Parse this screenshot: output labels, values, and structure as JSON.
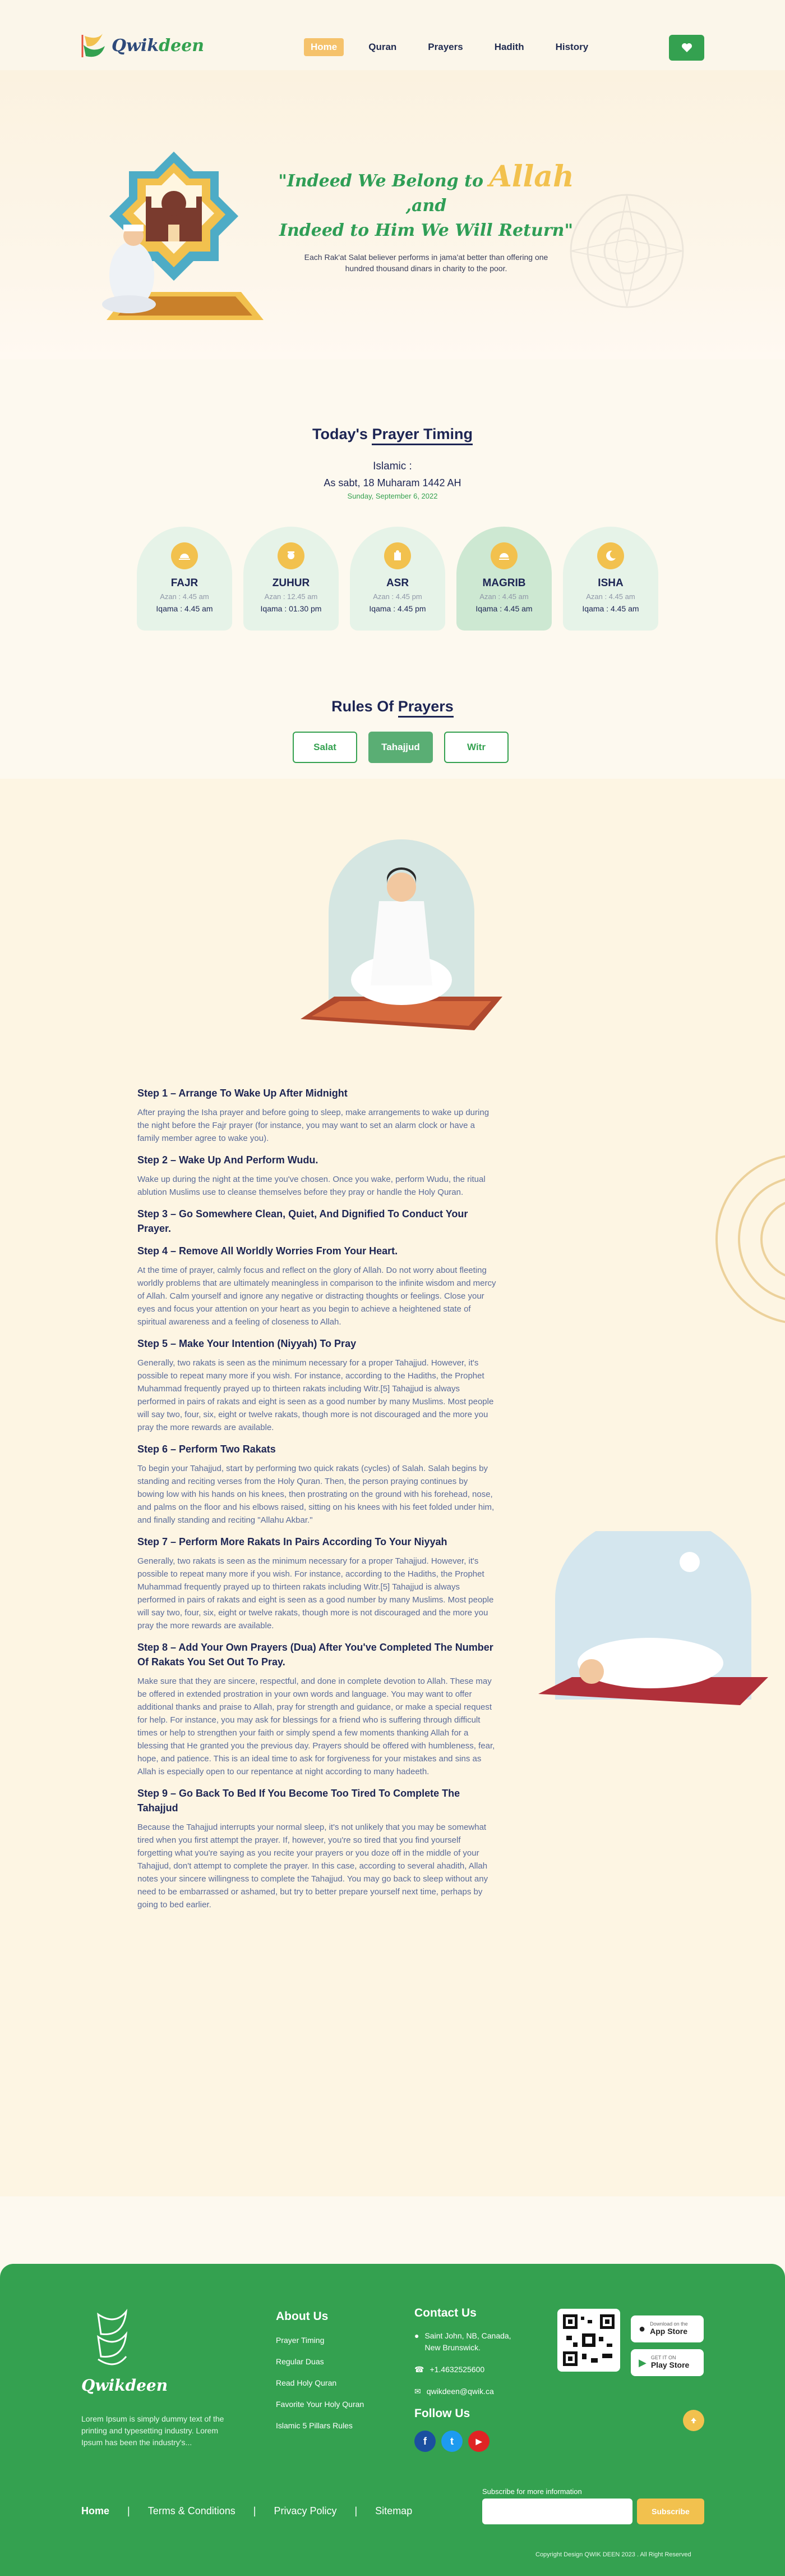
{
  "brand": {
    "logo_prefix": "Qwik",
    "logo_suffix": "deen"
  },
  "nav": {
    "items": [
      {
        "label": "Home",
        "active": true
      },
      {
        "label": "Quran",
        "active": false
      },
      {
        "label": "Prayers",
        "active": false
      },
      {
        "label": "Hadith",
        "active": false
      },
      {
        "label": "History",
        "active": false
      }
    ],
    "heart_icon": "heart-icon"
  },
  "hero": {
    "quote_before": "\"Indeed We Belong to",
    "quote_allah": "Allah",
    "quote_after": ",and",
    "quote_line2": "Indeed to Him We Will Return\"",
    "subtitle": "Each Rak'at Salat believer performs in jama'at better than offering one hundred thousand dinars in charity to the poor."
  },
  "timing": {
    "title_plain": "Today's",
    "title_ul": "Prayer Timing",
    "islamic_label": "Islamic :",
    "hijri_date": "As sabt, 18 Muharam 1442 AH",
    "greg_date": "Sunday, September 6, 2022",
    "prayers": [
      {
        "name": "FAJR",
        "azan": "Azan : 4.45 am",
        "iqama": "Iqama : 4.45 am",
        "icon": "sunrise-icon",
        "highlight": false
      },
      {
        "name": "ZUHUR",
        "azan": "Azan : 12.45 am",
        "iqama": "Iqama : 01.30 pm",
        "icon": "sun-icon",
        "highlight": false
      },
      {
        "name": "ASR",
        "azan": "Azan : 4.45 pm",
        "iqama": "Iqama : 4.45 pm",
        "icon": "sun-icon",
        "highlight": false
      },
      {
        "name": "MAGRIB",
        "azan": "Azan : 4.45 am",
        "iqama": "Iqama : 4.45 am",
        "icon": "sunset-icon",
        "highlight": true
      },
      {
        "name": "ISHA",
        "azan": "Azan : 4.45 am",
        "iqama": "Iqama : 4.45 am",
        "icon": "moon-icon",
        "highlight": false
      }
    ]
  },
  "rules": {
    "title_plain": "Rules Of",
    "title_ul": "Prayers",
    "tabs": [
      {
        "label": "Salat",
        "active": false
      },
      {
        "label": "Tahajjud",
        "active": true
      },
      {
        "label": "Witr",
        "active": false
      }
    ],
    "steps": [
      {
        "title": "Step 1 – Arrange To Wake Up After Midnight",
        "body": "After praying the Isha prayer and before going to sleep, make arrangements to wake up during the night before the Fajr prayer (for instance, you may want to set an alarm clock or have a family member agree to wake you)."
      },
      {
        "title": "Step 2 – Wake Up And Perform Wudu.",
        "body": "Wake up during the night at the time you've chosen. Once you wake, perform Wudu, the ritual ablution Muslims use to cleanse themselves before they pray or handle the Holy Quran."
      },
      {
        "title": "Step 3 – Go Somewhere Clean, Quiet, And Dignified To Conduct Your Prayer.",
        "body": ""
      },
      {
        "title": "Step 4 – Remove All Worldly Worries From Your Heart.",
        "body": "At the time of prayer, calmly focus and reflect on the glory of Allah. Do not worry about fleeting worldly problems that are ultimately meaningless in comparison to the infinite wisdom and mercy of Allah. Calm yourself and ignore any negative or distracting thoughts or feelings. Close your eyes and focus your attention on your heart as you begin to achieve a heightened state of spiritual awareness and a feeling of closeness to Allah."
      },
      {
        "title": "Step 5 – Make Your Intention (Niyyah) To Pray",
        "body": "Generally, two rakats is seen as the minimum necessary for a proper Tahajjud. However, it's possible to repeat many more if you wish. For instance, according to the Hadiths, the Prophet Muhammad frequently prayed up to thirteen rakats including Witr.[5] Tahajjud is always performed in pairs of rakats and eight is seen as a good number by many Muslims. Most people will say two, four, six, eight or twelve rakats, though more is not discouraged and the more you pray the more rewards are available."
      },
      {
        "title": "Step 6 – Perform Two Rakats",
        "body": "To begin your Tahajjud, start by performing two quick rakats (cycles) of Salah. Salah begins by standing and reciting verses from the Holy Quran. Then, the person praying continues by bowing low with his hands on his knees, then prostrating on the ground with his forehead, nose, and palms on the floor and his elbows raised, sitting on his knees with his feet folded under him, and finally standing and reciting \"Allahu Akbar.\""
      },
      {
        "title": "Step 7 – Perform More Rakats In Pairs According To Your Niyyah",
        "body": "Generally, two rakats is seen as the minimum necessary for a proper Tahajjud. However, it's possible to repeat many more if you wish. For instance, according to the Hadiths, the Prophet Muhammad frequently prayed up to thirteen rakats including Witr.[5] Tahajjud is always performed in pairs of rakats and eight is seen as a good number by many Muslims. Most people will say two, four, six, eight or twelve rakats, though more is not discouraged and the more you pray the more rewards are available."
      },
      {
        "title": "Step 8 – Add Your Own Prayers (Dua) After You've Completed The Number Of Rakats You Set Out To Pray.",
        "body": "Make sure that they are sincere, respectful, and done in complete devotion to Allah. These may be offered in extended prostration in your own words and language. You may want to offer additional thanks and praise to Allah, pray for strength and guidance, or make a special request for help. For instance, you may ask for blessings for a friend who is suffering through difficult times or help to strengthen your faith or simply spend a few moments thanking Allah for a blessing that He granted you the previous day. Prayers should be offered with humbleness, fear, hope, and patience. This is an ideal time to ask for forgiveness for your mistakes and sins as Allah is especially open to our repentance at night according to many hadeeth."
      },
      {
        "title": "Step 9 – Go Back To Bed If You Become Too Tired To Complete The Tahajjud",
        "body": "Because the Tahajjud interrupts your normal sleep, it's not unlikely that you may be somewhat tired when you first attempt the prayer. If, however, you're so tired that you find yourself forgetting what you're saying as you recite your prayers or you doze off in the middle of your Tahajjud, don't attempt to complete the prayer. In this case, according to several ahadith, Allah notes your sincere willingness to complete the Tahajjud. You may go back to sleep without any need to be embarrassed or ashamed, but try to better prepare yourself next time, perhaps by going to bed earlier."
      }
    ]
  },
  "footer": {
    "logo_prefix": "Qwik",
    "logo_suffix": "deen",
    "description": "Lorem Ipsum is simply dummy text of the printing and typesetting industry. Lorem Ipsum has been the industry's...",
    "about_title": "About Us",
    "about_links": [
      "Prayer Timing",
      "Regular Duas",
      "Read Holy Quran",
      "Favorite Your Holy Quran",
      "Islamic 5 Pillars Rules"
    ],
    "contact_title": "Contact Us",
    "address": "Saint John, NB, Canada, New Brunswick.",
    "phone": "+1.4632525600",
    "email": "qwikdeen@qwik.ca",
    "follow_title": "Follow Us",
    "socials": [
      {
        "name": "facebook-icon",
        "glyph": "f",
        "color": "#1b4fa0"
      },
      {
        "name": "twitter-icon",
        "glyph": "t",
        "color": "#1d9bf0"
      },
      {
        "name": "youtube-icon",
        "glyph": "▶",
        "color": "#e02424"
      }
    ],
    "app_store_small": "Download on the",
    "app_store_big": "App Store",
    "play_store_small": "GET IT ON",
    "play_store_big": "Play Store",
    "subscribe_label": "Subscribe for more information",
    "subscribe_placeholder": "",
    "subscribe_button": "Subscribe",
    "bottom_links": [
      "Home",
      "Terms & Conditions",
      "Privacy Policy",
      "Sitemap"
    ],
    "copyright": "Copyright Design QWIK DEEN 2023 . All Right Reserved"
  },
  "colors": {
    "green": "#34a150",
    "gold": "#f2c14e",
    "navy": "#1d2554",
    "cream": "#fdf5e3"
  }
}
